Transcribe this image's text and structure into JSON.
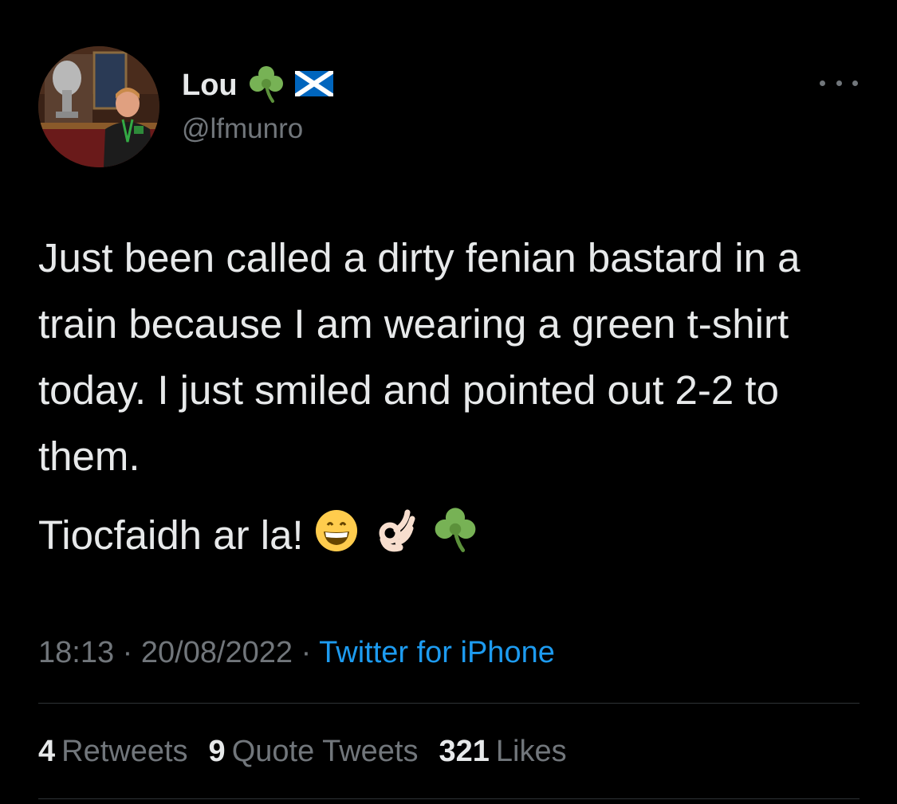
{
  "author": {
    "display_name": "Lou",
    "name_emojis": [
      "shamrock-icon",
      "scotland-flag-icon"
    ],
    "handle": "@lfmunro"
  },
  "tweet": {
    "paragraphs": [
      "Just been called a dirty fenian bastard in a train because I am wearing a green t-shirt today. I just smiled and pointed out 2-2 to them.",
      "Tiocfaidh ar la!"
    ],
    "trailing_emojis": [
      "grinning-face-icon",
      "ok-hand-icon",
      "shamrock-icon"
    ]
  },
  "meta": {
    "time": "18:13",
    "separator": " · ",
    "date": "20/08/2022",
    "source": "Twitter for iPhone"
  },
  "stats": {
    "retweets": {
      "count": "4",
      "label": "Retweets"
    },
    "quote_tweets": {
      "count": "9",
      "label": "Quote Tweets"
    },
    "likes": {
      "count": "321",
      "label": "Likes"
    }
  },
  "colors": {
    "background": "#000000",
    "primary_text": "#e7e9ea",
    "secondary_text": "#71767b",
    "link": "#1d9bf0",
    "divider": "#2f3336"
  }
}
